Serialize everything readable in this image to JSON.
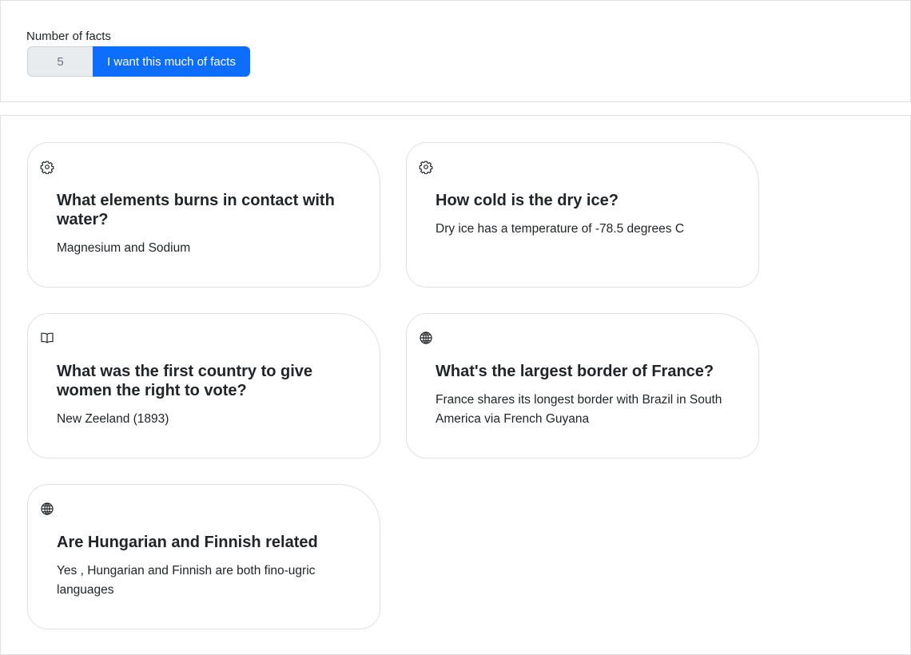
{
  "controls": {
    "label": "Number of facts",
    "count_value": "5",
    "submit_label": "I want this much of facts"
  },
  "facts": [
    {
      "icon": "gear-icon",
      "question": "What elements burns in contact with water?",
      "answer": "Magnesium and Sodium"
    },
    {
      "icon": "gear-icon",
      "question": "How cold is the dry ice?",
      "answer": "Dry ice has a temperature of -78.5 degrees C"
    },
    {
      "icon": "book-icon",
      "question": "What was the first country to give women the right to vote?",
      "answer": "New Zeeland (1893)"
    },
    {
      "icon": "globe-icon",
      "question": "What's the largest border of France?",
      "answer": "France shares its longest border with Brazil in South America via French Guyana"
    },
    {
      "icon": "globe-icon",
      "question": "Are Hungarian and Finnish related",
      "answer": "Yes , Hungarian and Finnish are both fino-ugric languages"
    }
  ],
  "colors": {
    "primary_button": "#0d6efd",
    "input_background": "#e9ecef",
    "border": "#dee2e6"
  }
}
